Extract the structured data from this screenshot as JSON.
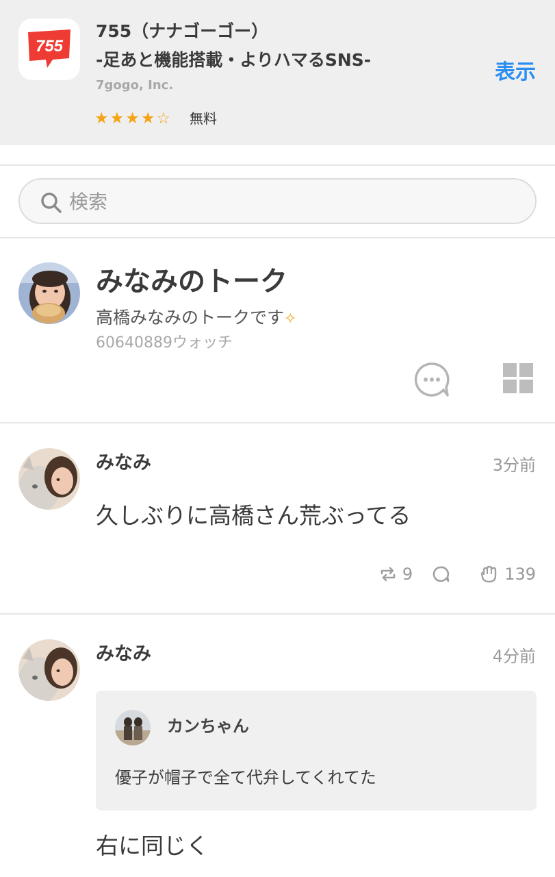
{
  "banner": {
    "app_icon_text": "755",
    "app_title": "755（ナナゴーゴー）",
    "app_subtitle": "-足あと機能搭載・よりハマるSNS-",
    "developer": "7gogo, Inc.",
    "rating": 4,
    "rating_max": 5,
    "price": "無料",
    "open_label": "表示",
    "accent_color": "#2a8ef0",
    "star_color": "#f5a312",
    "icon_color": "#ee3b33"
  },
  "search": {
    "placeholder": "検索",
    "value": ""
  },
  "talk": {
    "title": "みなみのトーク",
    "description": "高橋みなみのトークです",
    "description_emoji": "✧",
    "watch_count": "60640889ウォッチ"
  },
  "posts": [
    {
      "author": "みなみ",
      "time": "3分前",
      "body": "久しぶりに高橋さん荒ぶってる",
      "repost_count": "9",
      "comment_count": "",
      "like_count": "139"
    },
    {
      "author": "みなみ",
      "time": "4分前",
      "quote": {
        "author": "カンちゃん",
        "text": "優子が帽子で全て代弁してくれてた"
      },
      "body": "右に同じく"
    }
  ]
}
